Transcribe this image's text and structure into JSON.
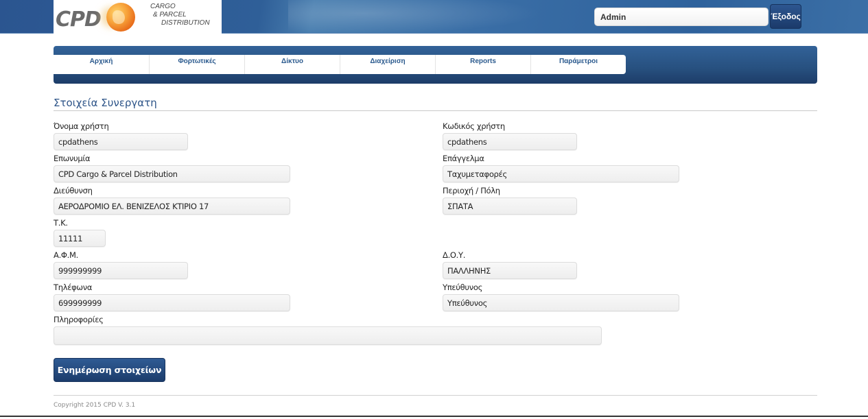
{
  "header": {
    "logo": {
      "brand": "CPD",
      "tagline": [
        "CARGO",
        "& PARCEL",
        "DISTRIBUTION"
      ]
    },
    "user_field_value": "Admin",
    "logout_label": "Έξοδος"
  },
  "nav": {
    "items": [
      {
        "label": "Αρχική"
      },
      {
        "label": "Φορτωτικές"
      },
      {
        "label": "Δίκτυο"
      },
      {
        "label": "Διαχείριση"
      },
      {
        "label": "Reports"
      },
      {
        "label": "Παράμετροι"
      }
    ]
  },
  "form": {
    "title": "Στοιχεία Συνεργατη",
    "fields": {
      "username": {
        "label": "Όνομα χρήστη",
        "value": "cpdathens"
      },
      "user_code": {
        "label": "Κωδικός χρήστη",
        "value": "cpdathens"
      },
      "company_name": {
        "label": "Επωνυμία",
        "value": "CPD Cargo & Parcel Distribution"
      },
      "profession": {
        "label": "Επάγγελμα",
        "value": "Ταχυμεταφορές"
      },
      "address": {
        "label": "Διεύθυνση",
        "value": "ΑΕΡΟΔΡΟΜΙΟ ΕΛ. ΒΕΝΙΖΕΛΟΣ ΚΤΙΡΙΟ 17"
      },
      "city": {
        "label": "Περιοχή / Πόλη",
        "value": "ΣΠΑΤΑ"
      },
      "postal_code": {
        "label": "Τ.Κ.",
        "value": "11111"
      },
      "vat": {
        "label": "Α.Φ.Μ.",
        "value": "999999999"
      },
      "tax_office": {
        "label": "Δ.Ο.Υ.",
        "value": "ΠΑΛΛΗΝΗΣ"
      },
      "phone": {
        "label": "Τηλέφωνα",
        "value": "699999999"
      },
      "manager": {
        "label": "Υπεύθυνος",
        "value": "Υπεύθυνος"
      },
      "info": {
        "label": "Πληροφορίες",
        "value": ""
      }
    },
    "submit_label": "Ενημέρωση στοιχείων"
  },
  "footer": {
    "copyright": "Copyright 2015 CPD V. 3.1"
  }
}
